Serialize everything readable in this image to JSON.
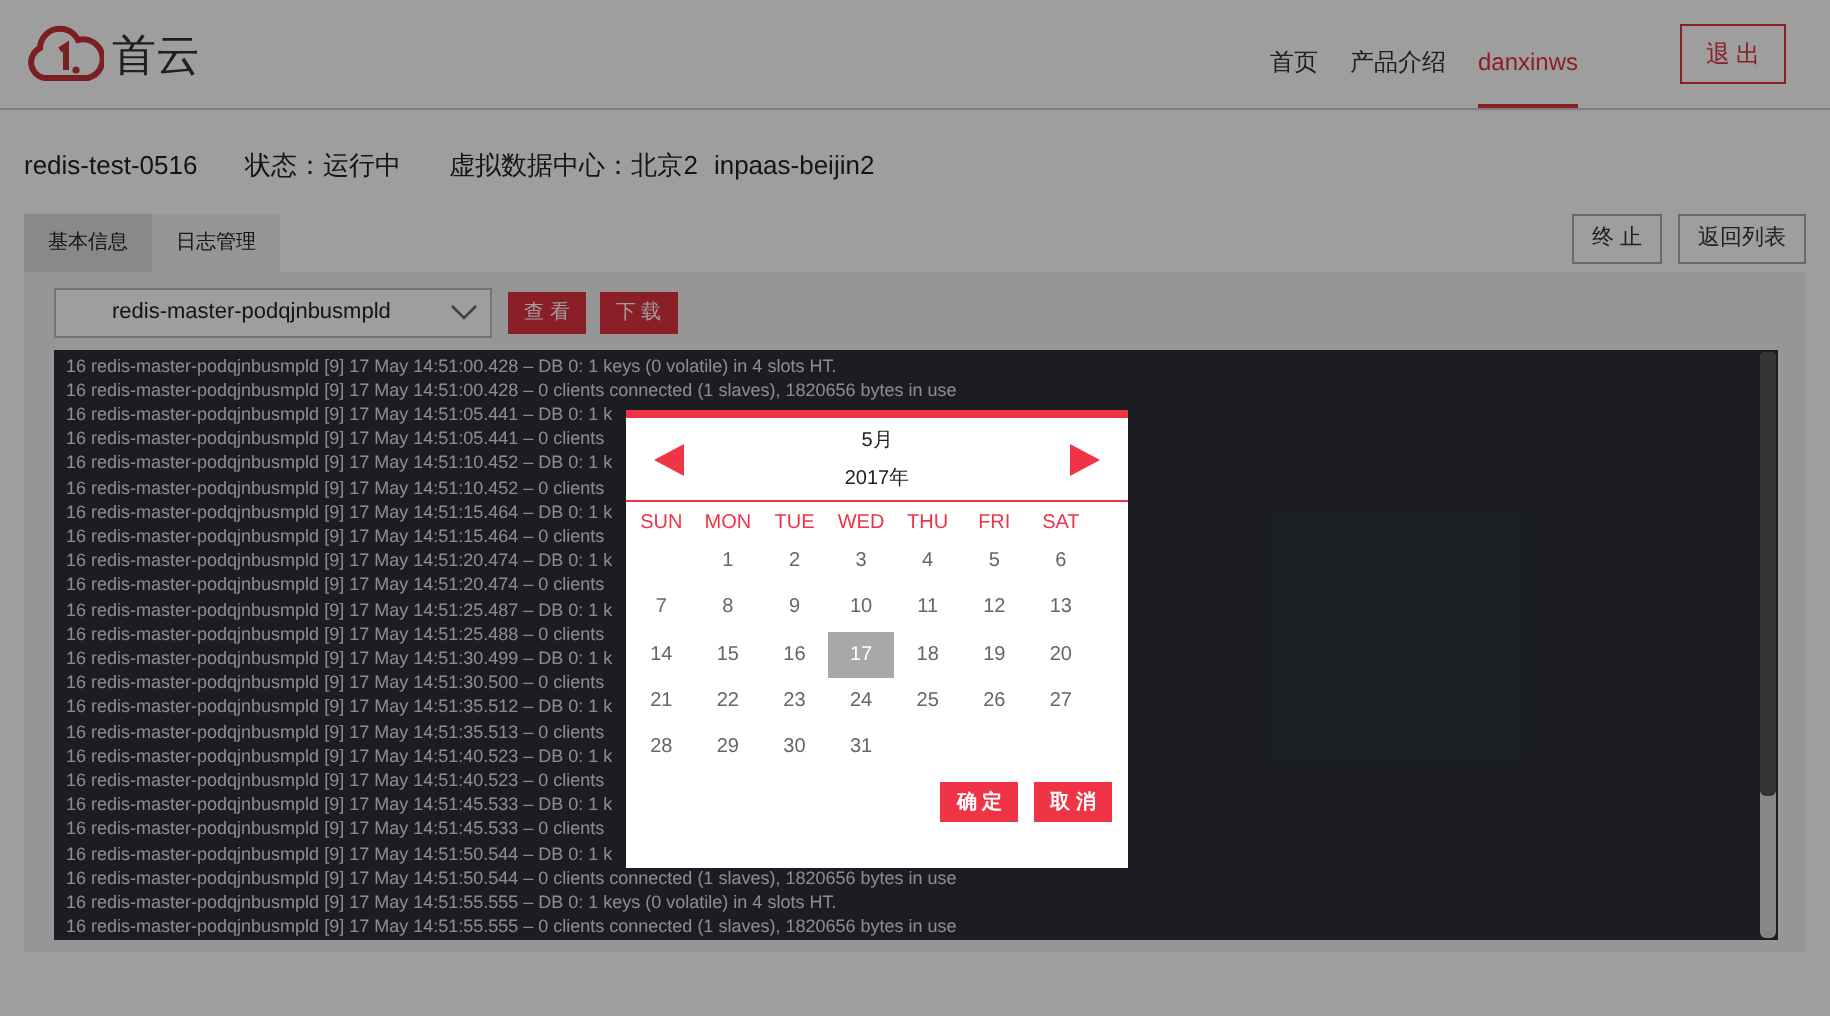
{
  "header": {
    "logo_text": "首云",
    "nav": [
      {
        "label": "首页",
        "selected": false
      },
      {
        "label": "产品介绍",
        "selected": false
      },
      {
        "label": "danxinws",
        "selected": true
      }
    ],
    "logout": "退 出"
  },
  "info": {
    "name": "redis-test-0516",
    "status_label": "状态：",
    "status": "运行中",
    "dc_label": "虚拟数据中心：",
    "dc": "北京2",
    "dc_id": "inpaas-beijin2"
  },
  "tabs": [
    {
      "label": "基本信息",
      "selected": true
    },
    {
      "label": "日志管理",
      "selected": false
    }
  ],
  "actions": [
    "终 止",
    "返回列表"
  ],
  "log_toolbar": {
    "select": "redis-master-podqjnbusmpld",
    "buttons": [
      "查 看",
      "下 载"
    ]
  },
  "log_lines": [
    "16 redis-master-podqjnbusmpld [9] 17 May 14:51:00.428 – DB 0: 1 keys (0 volatile) in 4 slots HT.",
    "16 redis-master-podqjnbusmpld [9] 17 May 14:51:00.428 – 0 clients connected (1 slaves), 1820656 bytes in use",
    "16 redis-master-podqjnbusmpld [9] 17 May 14:51:05.441 – DB 0: 1 k",
    "16 redis-master-podqjnbusmpld [9] 17 May 14:51:05.441 – 0 clients",
    "16 redis-master-podqjnbusmpld [9] 17 May 14:51:10.452 – DB 0: 1 k",
    "16 redis-master-podqjnbusmpld [9] 17 May 14:51:10.452 – 0 clients",
    "16 redis-master-podqjnbusmpld [9] 17 May 14:51:15.464 – DB 0: 1 k",
    "16 redis-master-podqjnbusmpld [9] 17 May 14:51:15.464 – 0 clients",
    "16 redis-master-podqjnbusmpld [9] 17 May 14:51:20.474 – DB 0: 1 k",
    "16 redis-master-podqjnbusmpld [9] 17 May 14:51:20.474 – 0 clients",
    "16 redis-master-podqjnbusmpld [9] 17 May 14:51:25.487 – DB 0: 1 k",
    "16 redis-master-podqjnbusmpld [9] 17 May 14:51:25.488 – 0 clients",
    "16 redis-master-podqjnbusmpld [9] 17 May 14:51:30.499 – DB 0: 1 k",
    "16 redis-master-podqjnbusmpld [9] 17 May 14:51:30.500 – 0 clients",
    "16 redis-master-podqjnbusmpld [9] 17 May 14:51:35.512 – DB 0: 1 k",
    "16 redis-master-podqjnbusmpld [9] 17 May 14:51:35.513 – 0 clients",
    "16 redis-master-podqjnbusmpld [9] 17 May 14:51:40.523 – DB 0: 1 k",
    "16 redis-master-podqjnbusmpld [9] 17 May 14:51:40.523 – 0 clients",
    "16 redis-master-podqjnbusmpld [9] 17 May 14:51:45.533 – DB 0: 1 k",
    "16 redis-master-podqjnbusmpld [9] 17 May 14:51:45.533 – 0 clients",
    "16 redis-master-podqjnbusmpld [9] 17 May 14:51:50.544 – DB 0: 1 k",
    "16 redis-master-podqjnbusmpld [9] 17 May 14:51:50.544 – 0 clients connected (1 slaves), 1820656 bytes in use",
    "16 redis-master-podqjnbusmpld [9] 17 May 14:51:55.555 – DB 0: 1 keys (0 volatile) in 4 slots HT.",
    "16 redis-master-podqjnbusmpld [9] 17 May 14:51:55.555 – 0 clients connected (1 slaves), 1820656 bytes in use"
  ],
  "calendar": {
    "month": "5月",
    "year": "2017年",
    "weekdays": [
      "SUN",
      "MON",
      "TUE",
      "WED",
      "THU",
      "FRI",
      "SAT"
    ],
    "weeks": [
      [
        {
          "kind": "blank"
        },
        {
          "kind": "day",
          "day": "1",
          "selected": false
        },
        {
          "kind": "day",
          "day": "2",
          "selected": false
        },
        {
          "kind": "day",
          "day": "3",
          "selected": false
        },
        {
          "kind": "day",
          "day": "4",
          "selected": false
        },
        {
          "kind": "day",
          "day": "5",
          "selected": false
        },
        {
          "kind": "day",
          "day": "6",
          "selected": false
        }
      ],
      [
        {
          "kind": "day",
          "day": "7",
          "selected": false
        },
        {
          "kind": "day",
          "day": "8",
          "selected": false
        },
        {
          "kind": "day",
          "day": "9",
          "selected": false
        },
        {
          "kind": "day",
          "day": "10",
          "selected": false
        },
        {
          "kind": "day",
          "day": "11",
          "selected": false
        },
        {
          "kind": "day",
          "day": "12",
          "selected": false
        },
        {
          "kind": "day",
          "day": "13",
          "selected": false
        }
      ],
      [
        {
          "kind": "day",
          "day": "14",
          "selected": false
        },
        {
          "kind": "day",
          "day": "15",
          "selected": false
        },
        {
          "kind": "day",
          "day": "16",
          "selected": false
        },
        {
          "kind": "day",
          "day": "17",
          "selected": true
        },
        {
          "kind": "day",
          "day": "18",
          "selected": false
        },
        {
          "kind": "day",
          "day": "19",
          "selected": false
        },
        {
          "kind": "day",
          "day": "20",
          "selected": false
        }
      ],
      [
        {
          "kind": "day",
          "day": "21",
          "selected": false
        },
        {
          "kind": "day",
          "day": "22",
          "selected": false
        },
        {
          "kind": "day",
          "day": "23",
          "selected": false
        },
        {
          "kind": "day",
          "day": "24",
          "selected": false
        },
        {
          "kind": "day",
          "day": "25",
          "selected": false
        },
        {
          "kind": "day",
          "day": "26",
          "selected": false
        },
        {
          "kind": "day",
          "day": "27",
          "selected": false
        }
      ],
      [
        {
          "kind": "day",
          "day": "28",
          "selected": false
        },
        {
          "kind": "day",
          "day": "29",
          "selected": false
        },
        {
          "kind": "day",
          "day": "30",
          "selected": false
        },
        {
          "kind": "day",
          "day": "31",
          "selected": false
        }
      ]
    ],
    "buttons": [
      "确 定",
      "取 消"
    ]
  }
}
